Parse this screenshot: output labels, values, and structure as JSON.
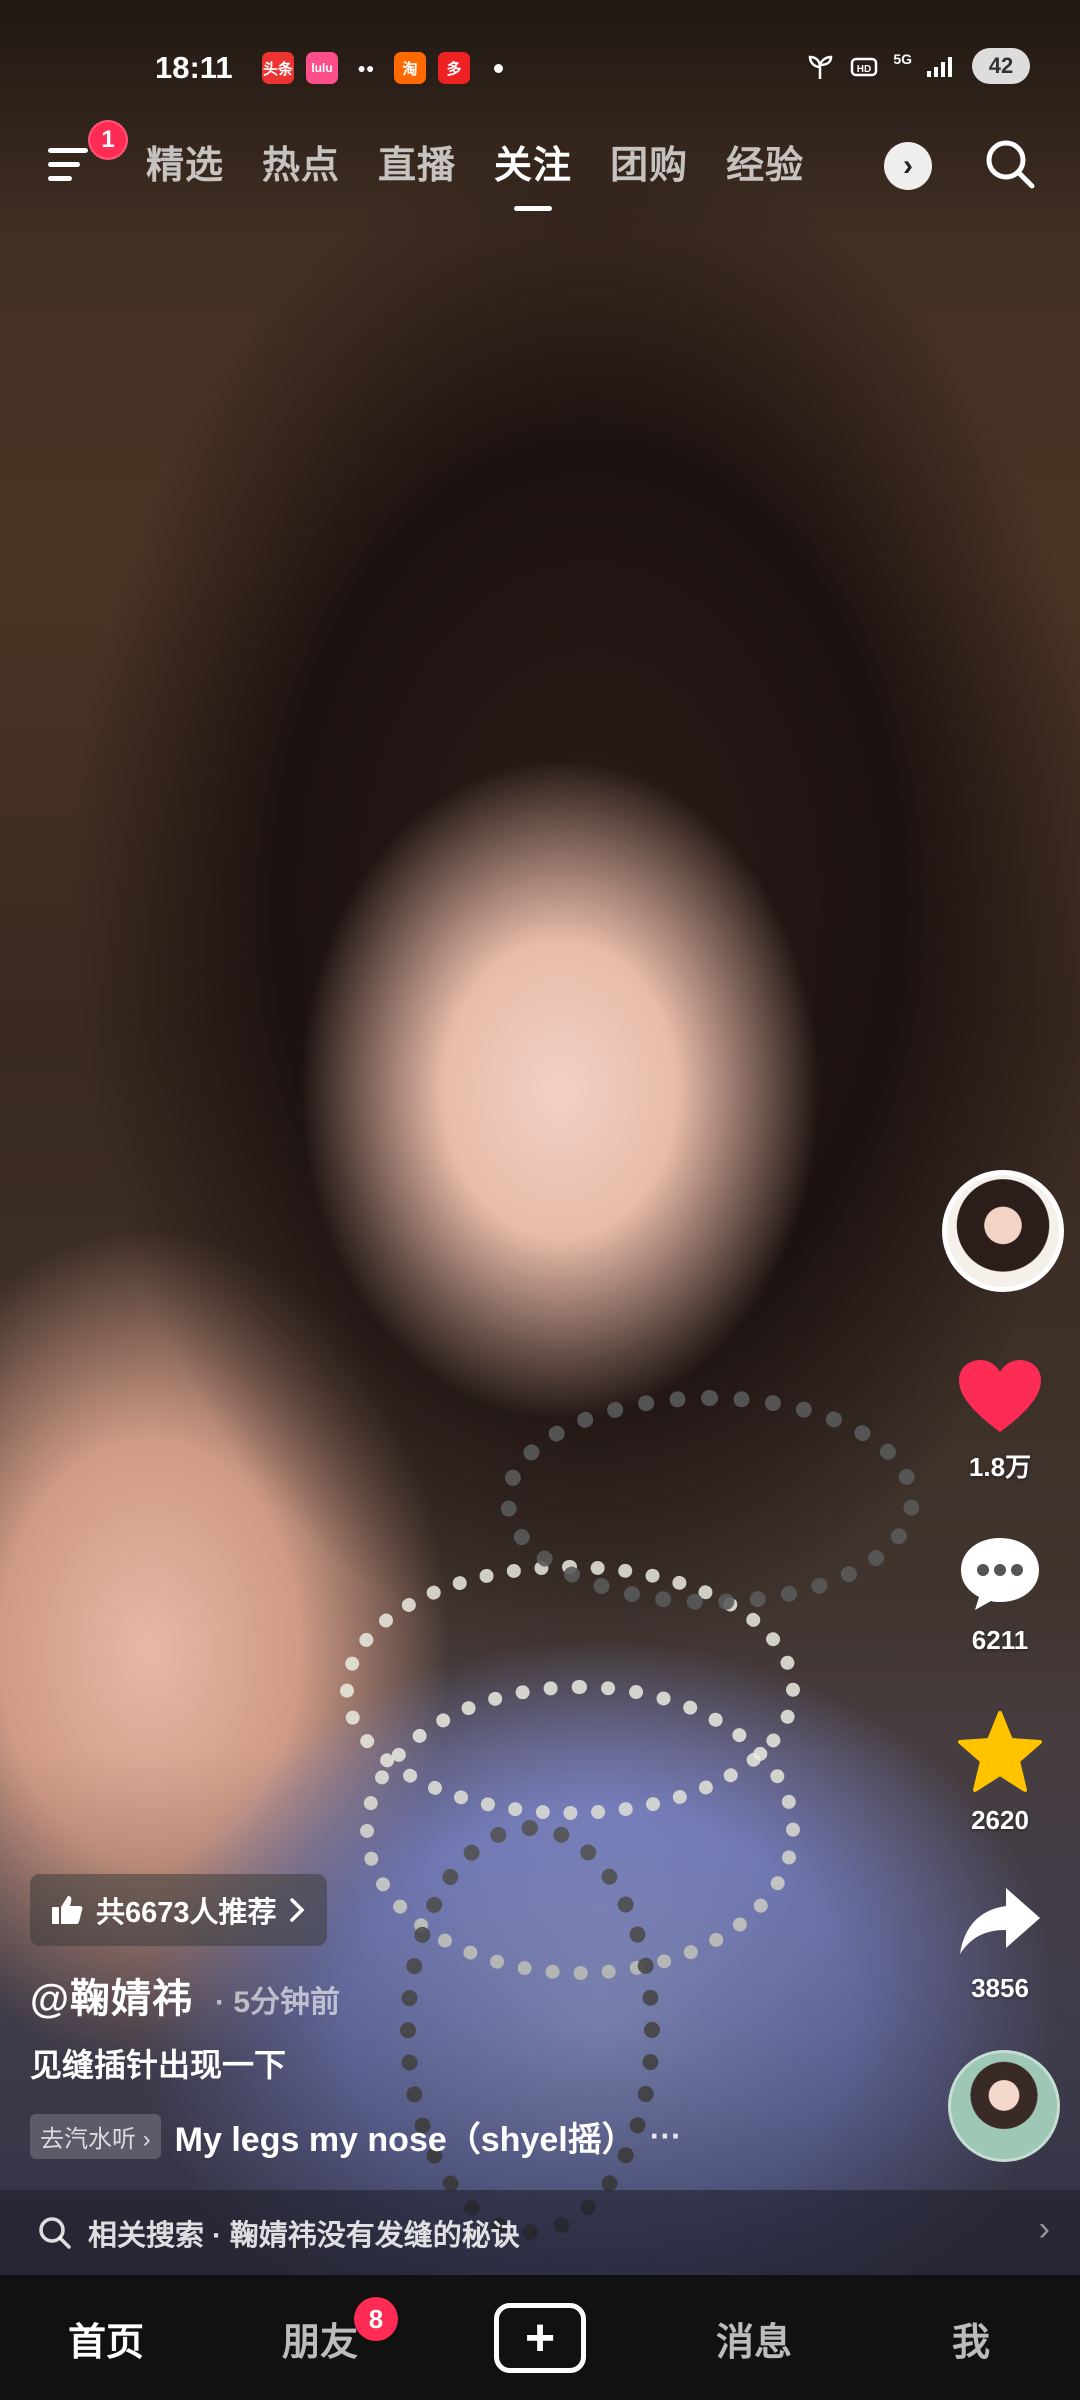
{
  "status_bar": {
    "time": "18:11",
    "notification_apps": [
      {
        "icon": "toutiao-app-icon",
        "text": "头条",
        "color": "#e33"
      },
      {
        "icon": "xiaohongshu-app-icon",
        "text": "lulu",
        "color": "#ff4f8a"
      },
      {
        "icon": "wechat-app-icon",
        "text": "●●",
        "color": "#2a2a2a"
      },
      {
        "icon": "taobao-app-icon",
        "text": "淘",
        "color": "#ff6a00"
      },
      {
        "icon": "pinduoduo-app-icon",
        "text": "多",
        "color": "#e22"
      }
    ],
    "network": "5G",
    "battery": "42"
  },
  "top_nav": {
    "menu_badge": "1",
    "tabs": [
      "精选",
      "热点",
      "直播",
      "关注",
      "团购",
      "经验"
    ],
    "active_tab": "关注",
    "more_glyph": "›"
  },
  "video": {
    "likes": "1.8万",
    "comments": "6211",
    "favorites": "2620",
    "shares": "3856",
    "recommend_text": "共6673人推荐",
    "author": "@鞠婧祎",
    "post_time": "· 5分钟前",
    "caption": "见缝插针出现一下",
    "music_tag": "去汽水听 ›",
    "music_title": "My legs my nose（shyel摇）",
    "music_ellipsis": "···"
  },
  "related_search": {
    "text": "相关搜索 · 鞠婧祎没有发缝的秘诀",
    "arrow": "›"
  },
  "bottom_nav": {
    "home": "首页",
    "friends": "朋友",
    "friends_badge": "8",
    "add": "+",
    "messages": "消息",
    "me": "我"
  },
  "colors": {
    "like_red": "#fe2c55",
    "favorite_yellow": "#ffc300",
    "badge_red": "#fe2c55"
  }
}
